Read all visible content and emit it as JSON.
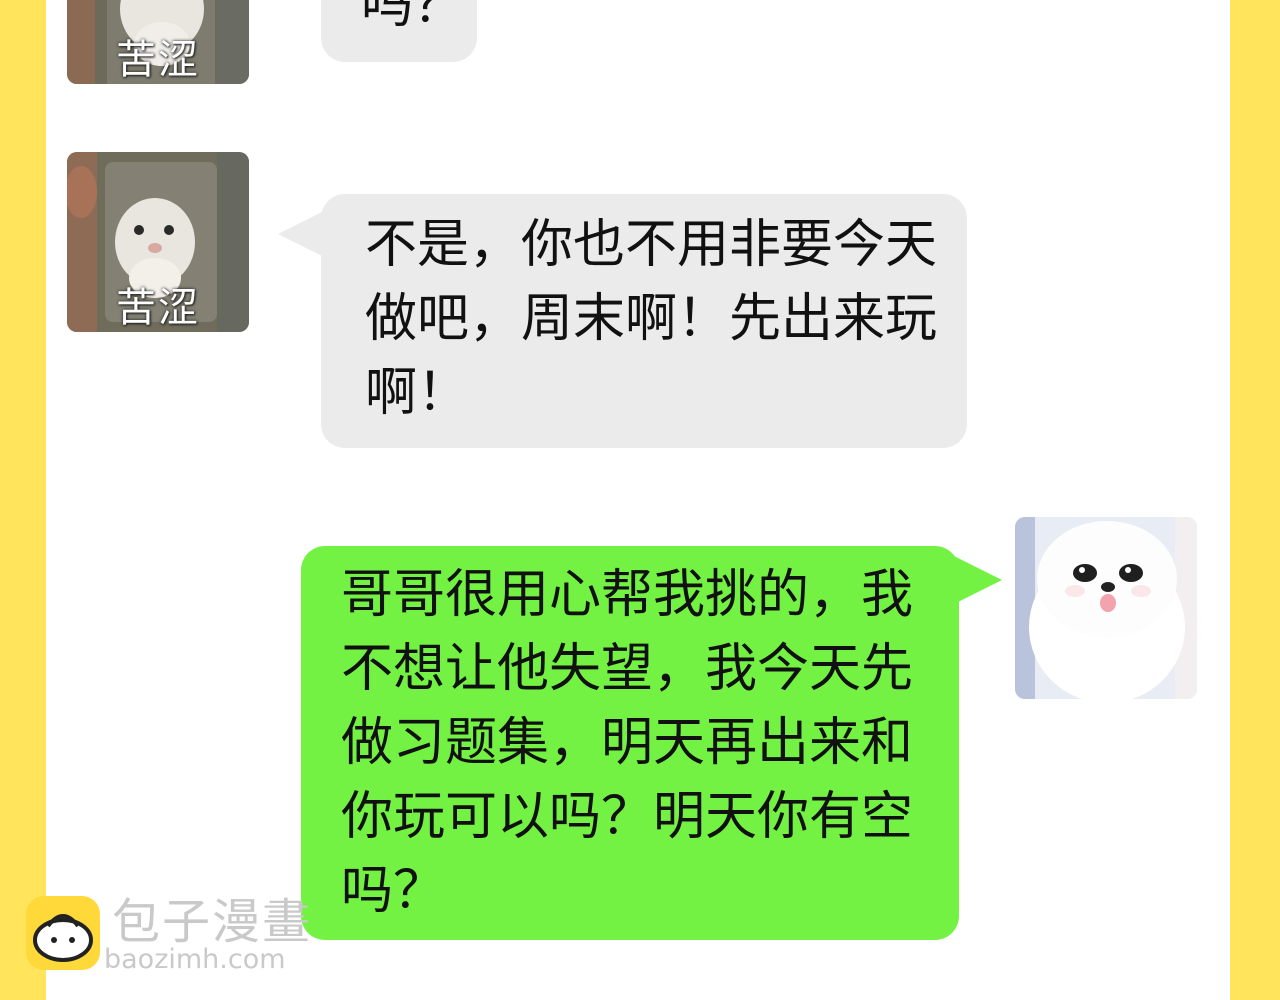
{
  "chat": {
    "messages": [
      {
        "sender": "left",
        "avatar_caption": "苦涩",
        "text": "吗？"
      },
      {
        "sender": "left",
        "avatar_caption": "苦涩",
        "text": "不是，你也不用非要今天做吧，周末啊！先出来玩啊！"
      },
      {
        "sender": "right",
        "text": "哥哥很用心帮我挑的，我不想让他失望，我今天先做习题集，明天再出来和你玩可以吗？明天你有空吗？"
      }
    ]
  },
  "watermark": {
    "title": "包子漫畫",
    "url": "baozimh.com"
  },
  "colors": {
    "frame": "#ffe45c",
    "gray_bubble": "#ebebeb",
    "green_bubble": "#74f244"
  }
}
